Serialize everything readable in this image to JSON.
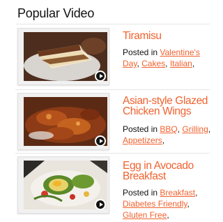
{
  "widget": {
    "title": "Popular Video"
  },
  "videos": [
    {
      "title": "Tiramisu",
      "posted_in_label": "Posted in",
      "categories": [
        "Valentine's Day",
        "Cakes",
        "Italian"
      ]
    },
    {
      "title": "Asian-style Glazed Chicken Wings",
      "posted_in_label": "Posted in",
      "categories": [
        "BBQ",
        "Grilling",
        "Appetizers"
      ]
    },
    {
      "title": "Egg in Avocado Breakfast",
      "posted_in_label": "Posted in",
      "categories": [
        "Breakfast",
        "Diabetes Friendly",
        "Gluten Free"
      ]
    }
  ],
  "icons": {
    "play": "play-icon"
  },
  "colors": {
    "accent": "#f0622f",
    "play_button": "#111111"
  }
}
